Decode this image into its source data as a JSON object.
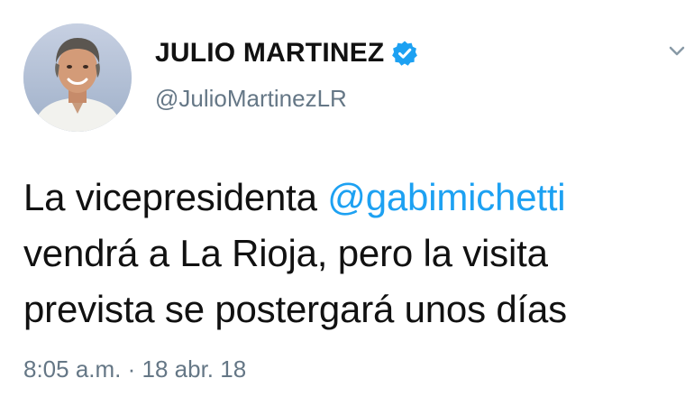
{
  "author": {
    "display_name": "JULIO MARTINEZ",
    "handle": "@JulioMartinezLR",
    "verified": true
  },
  "tweet": {
    "text_before": "La vicepresidenta ",
    "mention": "@gabimichetti",
    "text_after": " vendrá a La Rioja, pero la visita prevista se postergará unos días"
  },
  "meta": {
    "time": "8:05 a.m.",
    "separator": " · ",
    "date": "18 abr. 18"
  },
  "icons": {
    "verified": "verified-badge-icon",
    "caret": "chevron-down-icon"
  },
  "colors": {
    "accent": "#1da1f2",
    "secondary_text": "#657786"
  }
}
